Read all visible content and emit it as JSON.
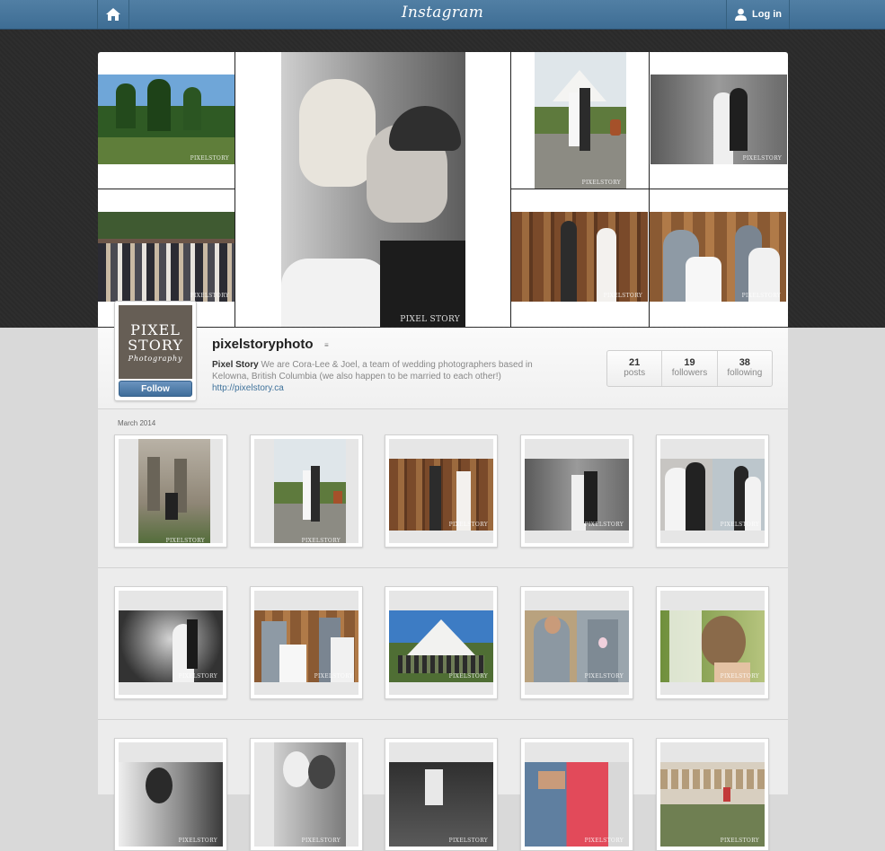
{
  "nav": {
    "brand": "Instagram",
    "login_label": "Log in"
  },
  "profile": {
    "avatar_line1": "PIXEL",
    "avatar_line2": "STORY",
    "avatar_line3": "Photography",
    "follow_label": "Follow",
    "username": "pixelstoryphoto",
    "bio_name": "Pixel Story",
    "bio_text": "We are Cora-Lee & Joel, a team of wedding photographers based in Kelowna, British Columbia (we also happen to be married to each other!)",
    "website": "http://pixelstory.ca",
    "stats": [
      {
        "value": "21",
        "label": "posts"
      },
      {
        "value": "19",
        "label": "followers"
      },
      {
        "value": "38",
        "label": "following"
      }
    ]
  },
  "feed": {
    "month_label": "March 2014",
    "watermark": "PIXELSTORY",
    "header_watermark": "PIXEL STORY"
  },
  "colors": {
    "nav": "#517fa4",
    "follow_button": "#3f6d9a",
    "link": "#3f729b",
    "avatar_bg": "#665e55"
  }
}
